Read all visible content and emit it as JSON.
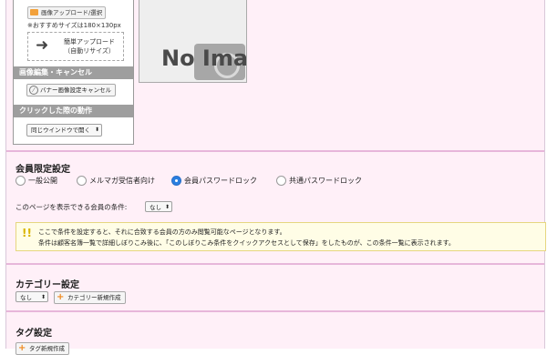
{
  "banner": {
    "upload_button_label": "画像アップロード/選択",
    "size_note": "※おすすめサイズは180×130px",
    "drop_text_line1": "簡単アップロード",
    "drop_text_line2": "（自動リサイズ）",
    "edit_header": "画像編集・キャンセル",
    "cancel_button_label": "バナー画像設定キャンセル",
    "click_header": "クリックした際の動作",
    "window_select_value": "同じウインドウで開く",
    "placeholder_text": "No Ima"
  },
  "member_limit": {
    "title": "会員限定設定",
    "options": [
      "一般公開",
      "メルマガ受信者向け",
      "会員パスワードロック",
      "共通パスワードロック"
    ],
    "selected_index": 2,
    "condition_label": "このページを表示できる会員の条件:",
    "condition_value": "なし",
    "note_line1": "ここで条件を設定すると、それに合致する会員の方のみ閲覧可能なページとなります。",
    "note_line2": "条件は顧客名簿一覧で詳細しぼりこみ後に、「このしぼりこみ条件をクイックアクセスとして保存」をしたものが、この条件一覧に表示されます。"
  },
  "category": {
    "title": "カテゴリー設定",
    "select_value": "なし",
    "new_button_label": "カテゴリー新規作成"
  },
  "tags": {
    "title": "タグ設定",
    "button_label": "タグ新規作成"
  }
}
